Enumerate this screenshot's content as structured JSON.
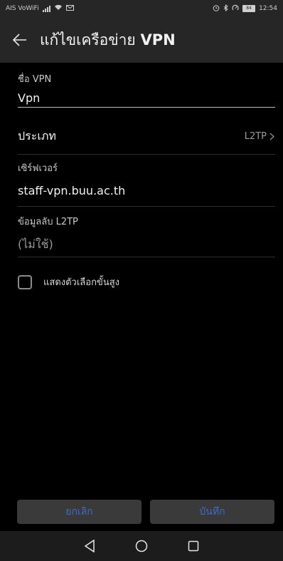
{
  "status_bar": {
    "carrier": "AIS VoWiFi",
    "volte_badge": "VoWiFi",
    "battery": "84",
    "time": "12:54"
  },
  "header": {
    "title_prefix": "แก้ไขเครือข่าย",
    "title_bold": "VPN"
  },
  "form": {
    "name_label": "ชื่อ VPN",
    "name_value": "Vpn",
    "type_label": "ประเภท",
    "type_value": "L2TP",
    "server_label": "เซิร์ฟเวอร์",
    "server_value": "staff-vpn.buu.ac.th",
    "secret_label": "ข้อมูลลับ L2TP",
    "secret_value": "(ไม่ใช้)",
    "advanced_label": "แสดงตัวเลือกขั้นสูง"
  },
  "buttons": {
    "cancel": "ยกเลิก",
    "save": "บันทึก"
  },
  "colors": {
    "background": "#000000",
    "bar": "#262626",
    "accent": "#3f6cc8",
    "button_bg": "#3a3a3a"
  }
}
